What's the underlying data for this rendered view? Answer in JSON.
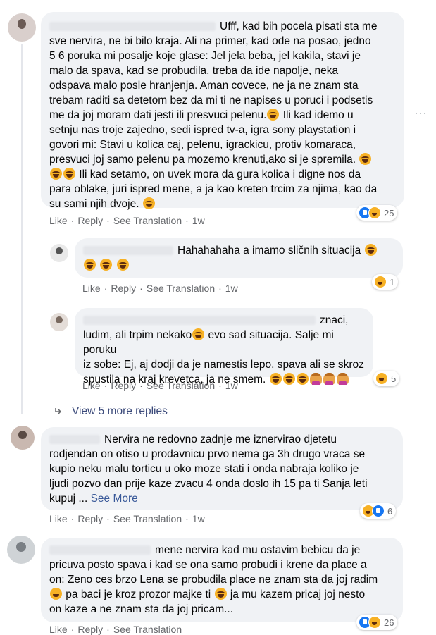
{
  "actions": {
    "like": "Like",
    "reply": "Reply",
    "translate": "See Translation",
    "time": "1w",
    "see_more": "See More",
    "view_more_replies": "View 5 more replies"
  },
  "comments": [
    {
      "text": "Ufff, kad bih pocela pisati sta me\nsve nervira, ne bi bilo kraja. Ali na primer, kad ode na posao, jedno\n5 6 poruka mi posalje koje glase: Jel jela beba, jel kakila, stavi je\nmalo da spava, kad se probudila, treba da ide napolje, neka\nodspava malo posle hranjenja. Aman covece, ne ja ne znam sta\ntrebam raditi sa detetom bez da mi ti ne napises u poruci i podsetis\nme da joj moram dati jesti ili presvuci pelenu.",
      "text2": " Ili kad idemo u\nsetnju nas troje zajedno, sedi ispred tv-a, igra sony playstation i\ngovori mi: Stavi u kolica caj, pelenu, igrackicu, protiv komaraca,\npresvuci joj samo pelenu pa mozemo krenuti,ako si je spremila. ",
      "text3": " Ili kad setamo, on uvek mora da gura kolica i digne nos da\npara oblake, juri ispred mene, a ja kao kreten trcim za njima, kao da\nsu sami njih dvoje. ",
      "reactions": "25"
    },
    {
      "text": "Hahahahaha a imamo sličnih situacija ",
      "reactions": "1"
    },
    {
      "text": "znaci,\nludim, ali trpim nekako",
      "text2": " evo sad situacija. Salje mi poruku\niz sobe: Ej, aj dodji da je namestis lepo, spava ali se skroz\nspustila na kraj krevetca, ja ne smem. ",
      "reactions": "5"
    },
    {
      "text": "Nervira ne redovno zadnje me iznervirao djetetu\nrodjendan on otiso u prodavnicu prvo nema ga 3h drugo vraca se\nkupio neku malu torticu u oko moze stati i onda nabraja koliko je\nljudi pozvo dan prije kaze zvacu 4 onda doslo ih 15 pa ti Sanja leti\nkupuj ... ",
      "reactions": "6"
    },
    {
      "text": "mene nervira kad mu ostavim bebicu da je\npricuva posto spava i kad se ona samo probudi i krene da place a\non: Zeno ces brzo Lena se probudila place ne znam sta da joj radim\n",
      "text2": " pa baci je kroz prozor majke ti ",
      "text3": " ja mu kazem pricaj joj nesto\non kaze a ne znam sta da joj pricam...",
      "reactions": "26"
    }
  ],
  "colors": {
    "bubble": "#f0f2f5",
    "meta": "#65676b",
    "like_blue": "#1877f2",
    "haha_yellow": "#f7b125"
  },
  "icons": [
    "like-icon",
    "haha-icon",
    "laughing-emoji",
    "grinning-emoji",
    "woman-facepalm-emoji",
    "reply-arrow-icon",
    "more-options-icon"
  ]
}
